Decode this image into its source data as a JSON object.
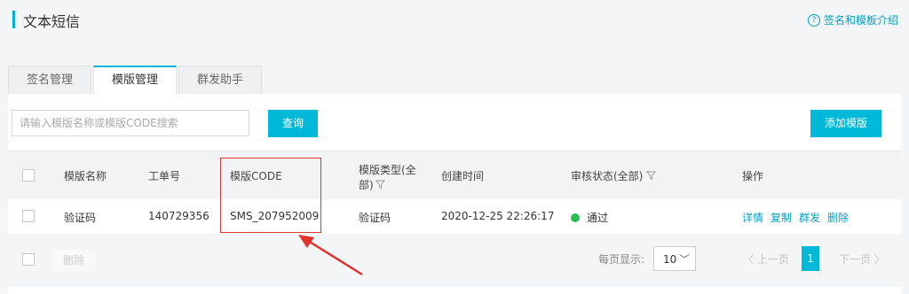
{
  "header": {
    "title": "文本短信",
    "intro_label": "签名和模板介绍",
    "intro_icon": "question-icon"
  },
  "tabs": [
    {
      "label": "签名管理"
    },
    {
      "label": "模版管理"
    },
    {
      "label": "群发助手"
    }
  ],
  "toolbar": {
    "search_placeholder": "请输入模版名称或模版CODE搜索",
    "search_button": "查询",
    "add_button": "添加模版"
  },
  "table": {
    "headers": {
      "name": "模版名称",
      "ticket": "工单号",
      "code": "模版CODE",
      "type_line1": "模版类型(全",
      "type_line2": "部)",
      "created": "创建时间",
      "status": "审核状态(全部)",
      "actions": "操作"
    },
    "rows": [
      {
        "name": "验证码",
        "ticket": "140729356",
        "code": "SMS_207952009",
        "type": "验证码",
        "created": "2020-12-25 22:26:17",
        "status": "通过",
        "status_color": "#2dbb55",
        "actions": [
          "详情",
          "复制",
          "群发",
          "删除"
        ]
      }
    ]
  },
  "footer": {
    "delete_label": "删除",
    "per_page_label": "每页显示:",
    "per_page_value": "10",
    "prev_label": "上一页",
    "current_page": "1",
    "next_label": "下一页"
  },
  "colors": {
    "accent": "#00b9d9",
    "annotation": "#e0322f"
  }
}
